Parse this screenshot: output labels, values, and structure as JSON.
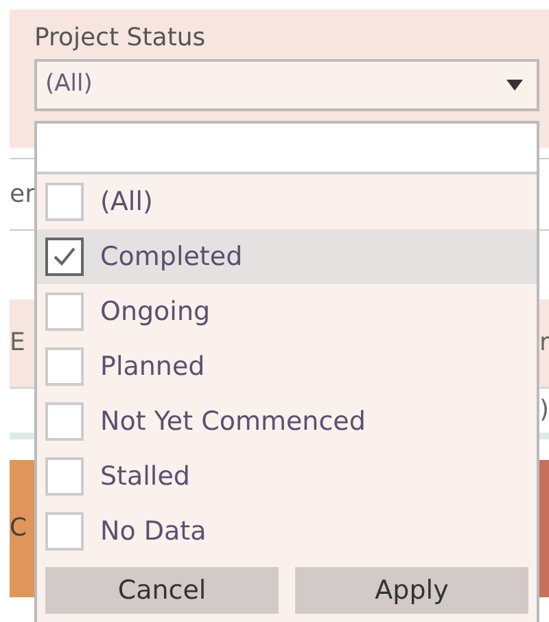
{
  "filter": {
    "title": "Project Status",
    "value": "(All)"
  },
  "background_rows": [
    {
      "kind": "plain",
      "left": "er"
    },
    {
      "kind": "pink",
      "left": "E",
      "right": "r"
    },
    {
      "kind": "plain",
      "right": ")"
    },
    {
      "kind": "orange",
      "left": "C"
    }
  ],
  "options": [
    {
      "label": "(All)",
      "checked": false,
      "selected": false
    },
    {
      "label": "Completed",
      "checked": true,
      "selected": true
    },
    {
      "label": "Ongoing",
      "checked": false,
      "selected": false
    },
    {
      "label": "Planned",
      "checked": false,
      "selected": false
    },
    {
      "label": "Not Yet Commenced",
      "checked": false,
      "selected": false
    },
    {
      "label": "Stalled",
      "checked": false,
      "selected": false
    },
    {
      "label": "No Data",
      "checked": false,
      "selected": false
    }
  ],
  "buttons": [
    "Cancel",
    "Apply"
  ]
}
